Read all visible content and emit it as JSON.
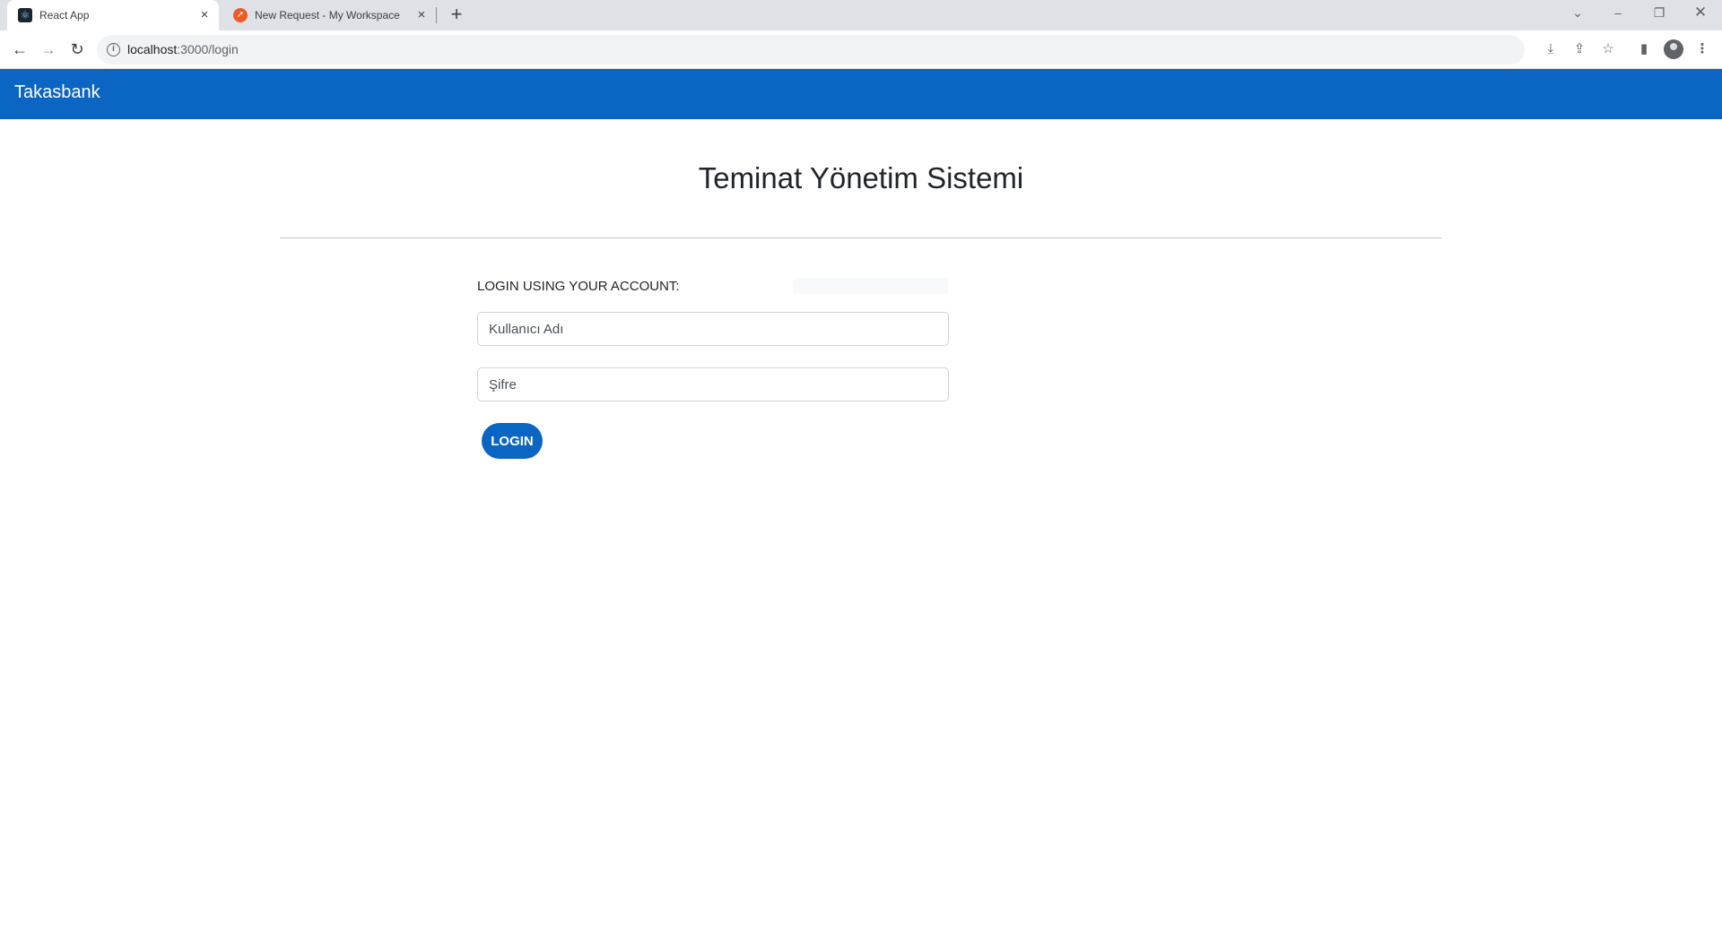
{
  "browser": {
    "tabs": [
      {
        "title": "React App",
        "favicon": "react-icon",
        "active": true
      },
      {
        "title": "New Request - My Workspace",
        "favicon": "postman-icon",
        "active": false
      }
    ],
    "address": {
      "host": "localhost",
      "path": ":3000/login"
    }
  },
  "navbar": {
    "brand": "Takasbank",
    "color": "#0b65c2"
  },
  "page": {
    "title": "Teminat Yönetim Sistemi",
    "login_heading": "LOGIN USING YOUR ACCOUNT:",
    "username_placeholder": "Kullanıcı Adı",
    "password_placeholder": "Şifre",
    "login_button": "LOGIN"
  }
}
